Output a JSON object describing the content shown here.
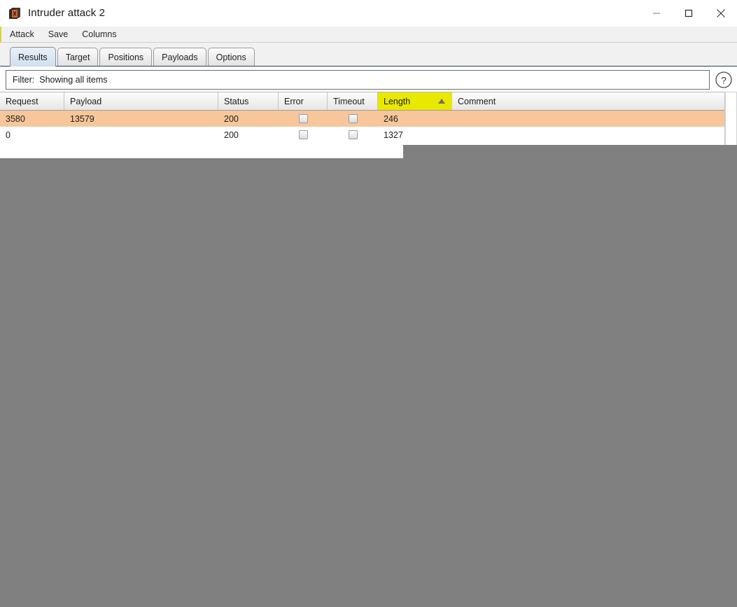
{
  "window": {
    "title": "Intruder attack 2",
    "app_icon": "burp-suite-icon",
    "controls": {
      "minimize": "minimize-icon",
      "maximize": "maximize-icon",
      "close": "close-icon"
    }
  },
  "menubar": {
    "items": [
      {
        "label": "Attack"
      },
      {
        "label": "Save"
      },
      {
        "label": "Columns"
      }
    ]
  },
  "tabs": [
    {
      "label": "Results",
      "selected": true
    },
    {
      "label": "Target",
      "selected": false
    },
    {
      "label": "Positions",
      "selected": false
    },
    {
      "label": "Payloads",
      "selected": false
    },
    {
      "label": "Options",
      "selected": false
    }
  ],
  "filter": {
    "label": "Filter:",
    "value": "Showing all items",
    "help_icon": "help-question-icon"
  },
  "table": {
    "columns": [
      {
        "label": "Request",
        "sorted": false
      },
      {
        "label": "Payload",
        "sorted": false
      },
      {
        "label": "Status",
        "sorted": false
      },
      {
        "label": "Error",
        "sorted": false
      },
      {
        "label": "Timeout",
        "sorted": false
      },
      {
        "label": "Length",
        "sorted": true,
        "sort_direction": "ascending",
        "sort_arrow": "▲",
        "highlight_color": "#e9e900"
      },
      {
        "label": "Comment",
        "sorted": false
      }
    ],
    "rows": [
      {
        "request": "3580",
        "payload": "13579",
        "status": "200",
        "error": false,
        "timeout": false,
        "length": "246",
        "comment": "",
        "highlighted": true,
        "highlight_color": "#f7c69a"
      },
      {
        "request": "0",
        "payload": "",
        "status": "200",
        "error": false,
        "timeout": false,
        "length": "1327",
        "comment": "",
        "highlighted": false
      }
    ],
    "scrollbar": {
      "up_arrow": "scroll-up-icon"
    }
  }
}
